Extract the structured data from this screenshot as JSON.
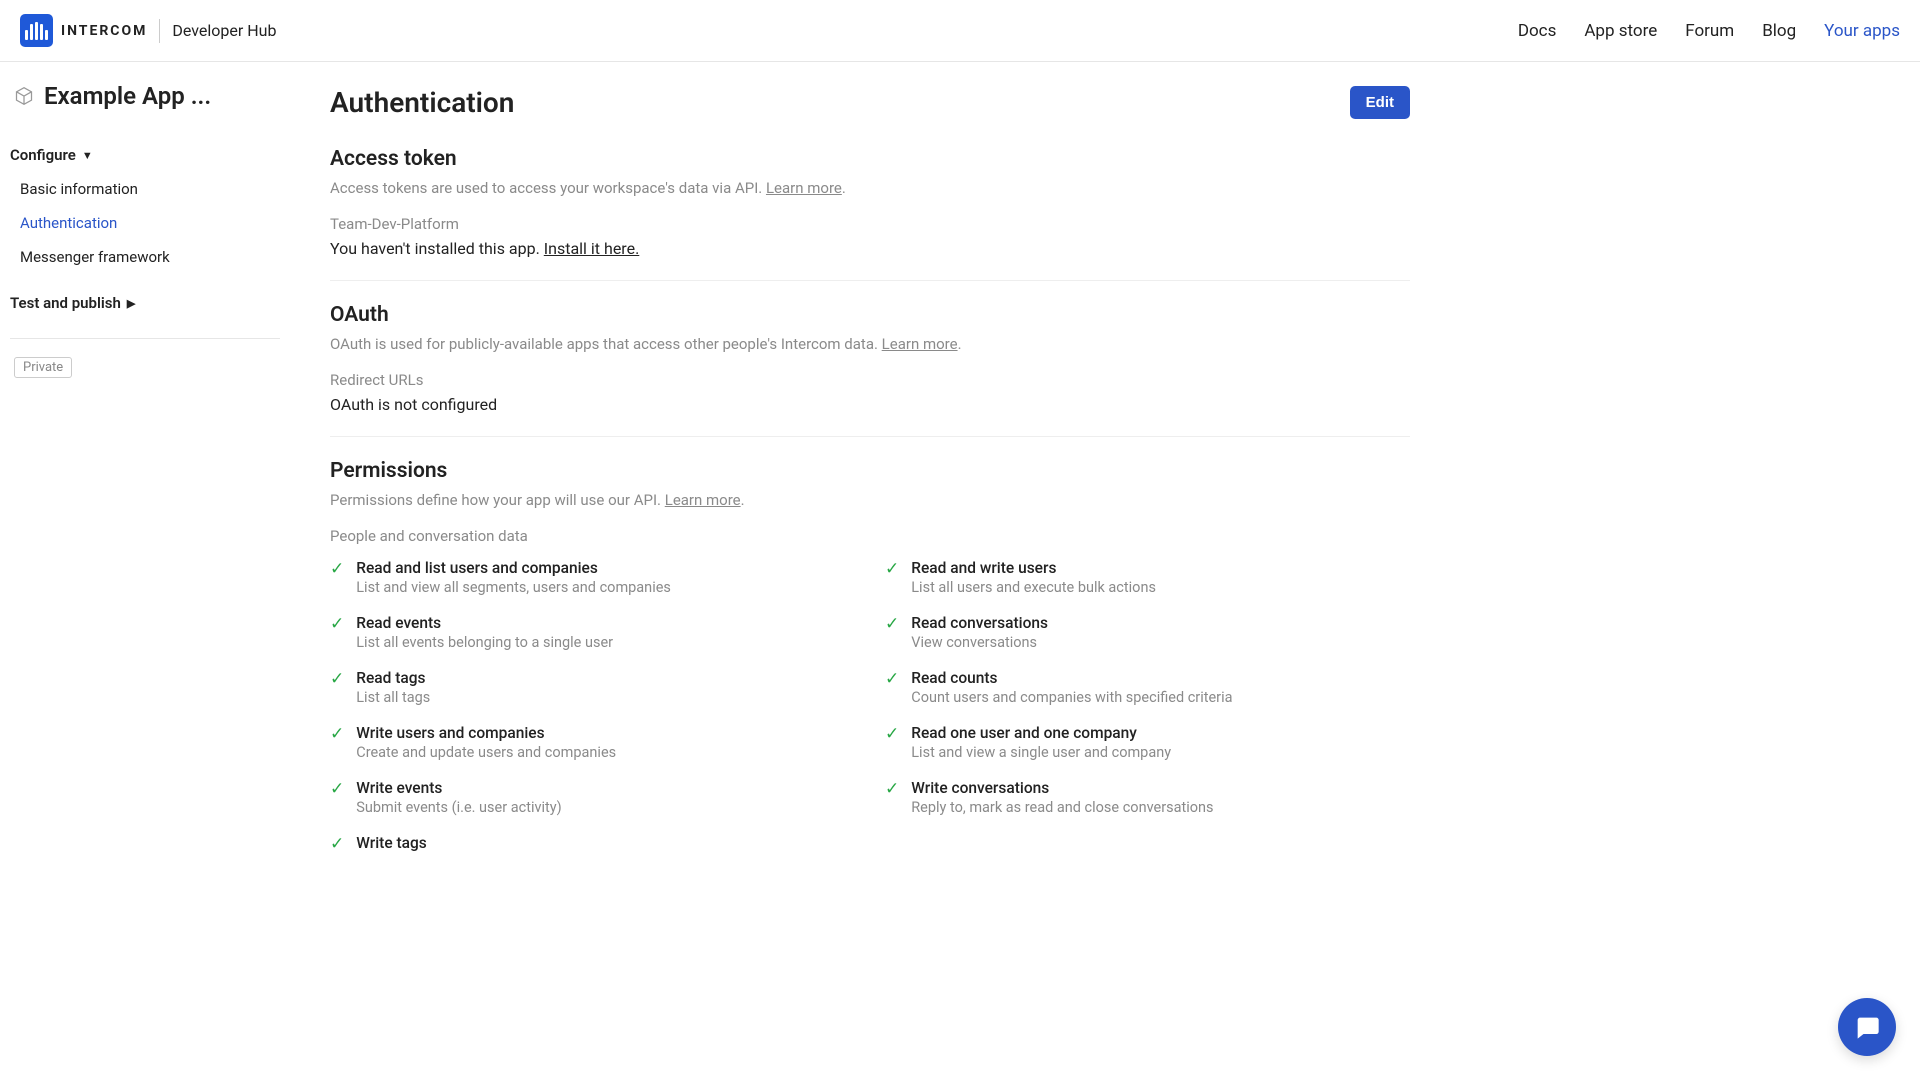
{
  "header": {
    "brand": "INTERCOM",
    "subtitle": "Developer Hub",
    "nav": {
      "docs": "Docs",
      "app_store": "App store",
      "forum": "Forum",
      "blog": "Blog",
      "your_apps": "Your apps"
    }
  },
  "sidebar": {
    "app_title": "Example App ...",
    "configure": "Configure",
    "items": {
      "basic_info": "Basic information",
      "authentication": "Authentication",
      "messenger_framework": "Messenger framework"
    },
    "test_publish": "Test and publish",
    "badge": "Private"
  },
  "main": {
    "title": "Authentication",
    "edit": "Edit",
    "access_token": {
      "heading": "Access token",
      "desc_pre": "Access tokens are used to access your workspace's data via API. ",
      "learn_more": "Learn more",
      "desc_post": ".",
      "workspace_label": "Team-Dev-Platform",
      "not_installed_pre": "You haven't installed this app. ",
      "install_link": "Install it here."
    },
    "oauth": {
      "heading": "OAuth",
      "desc_pre": "OAuth is used for publicly-available apps that access other people's Intercom data. ",
      "learn_more": "Learn more",
      "desc_post": ".",
      "redirect_label": "Redirect URLs",
      "status": "OAuth is not configured"
    },
    "permissions": {
      "heading": "Permissions",
      "desc_pre": "Permissions define how your app will use our API. ",
      "learn_more": "Learn more",
      "desc_post": ".",
      "group_label": "People and conversation data",
      "items": [
        {
          "title": "Read and list users and companies",
          "desc": "List and view all segments, users and companies"
        },
        {
          "title": "Read and write users",
          "desc": "List all users and execute bulk actions"
        },
        {
          "title": "Read events",
          "desc": "List all events belonging to a single user"
        },
        {
          "title": "Read conversations",
          "desc": "View conversations"
        },
        {
          "title": "Read tags",
          "desc": "List all tags"
        },
        {
          "title": "Read counts",
          "desc": "Count users and companies with specified criteria"
        },
        {
          "title": "Write users and companies",
          "desc": "Create and update users and companies"
        },
        {
          "title": "Read one user and one company",
          "desc": "List and view a single user and company"
        },
        {
          "title": "Write events",
          "desc": "Submit events (i.e. user activity)"
        },
        {
          "title": "Write conversations",
          "desc": "Reply to, mark as read and close conversations"
        },
        {
          "title": "Write tags",
          "desc": ""
        }
      ]
    }
  }
}
